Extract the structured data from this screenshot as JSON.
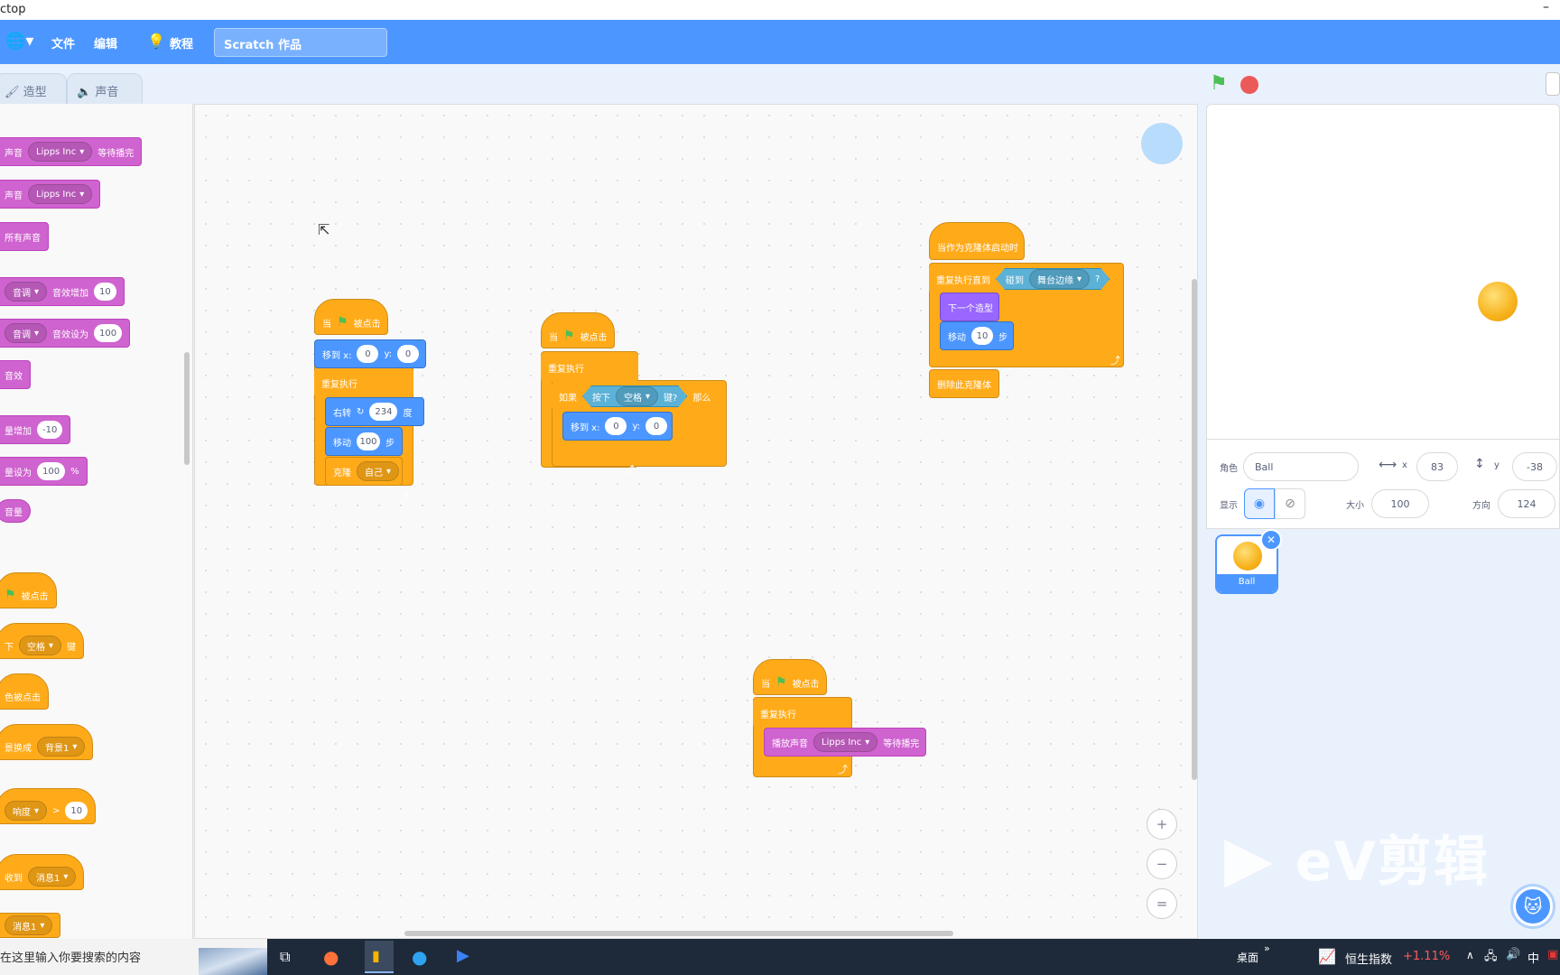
{
  "window": {
    "title": "ctop",
    "minimize": "–"
  },
  "menubar": {
    "file": "文件",
    "edit": "编辑",
    "tutorial": "教程",
    "project_title": "Scratch 作品"
  },
  "tabs": [
    {
      "label": "造型"
    },
    {
      "label": "声音"
    }
  ],
  "palette": {
    "b1": {
      "text": "声音",
      "dd": "Lipps Inc",
      "tail": "等待播完"
    },
    "b2": {
      "text": "声音",
      "dd": "Lipps Inc"
    },
    "b3": {
      "text": "所有声音"
    },
    "b4": {
      "dd": "音调",
      "text": "音效增加",
      "val": "10"
    },
    "b5": {
      "dd": "音调",
      "text": "音效设为",
      "val": "100"
    },
    "b6": {
      "text": "音效"
    },
    "b7": {
      "text": "量增加",
      "val": "-10"
    },
    "b8": {
      "text": "量设为",
      "val": "100",
      "tail": "%"
    },
    "b9": {
      "text": "音量"
    },
    "b10": {
      "text": "被点击"
    },
    "b11": {
      "text": "下",
      "dd": "空格",
      "tail": "键"
    },
    "b12": {
      "text": "色被点击"
    },
    "b13": {
      "text": "景换成",
      "dd": "背景1"
    },
    "b14": {
      "dd": "响度",
      "text": ">",
      "val": "10"
    },
    "b15": {
      "text": "收到",
      "dd": "消息1"
    },
    "b16": {
      "dd": "消息1"
    }
  },
  "scripts": {
    "s1": {
      "hat_a": "当",
      "hat_b": "被点击",
      "goto": "移到 x:",
      "x": "0",
      "y_label": "y:",
      "y": "0",
      "forever": "重复执行",
      "turn": "右转",
      "turn_val": "234",
      "deg": "度",
      "move": "移动",
      "move_val": "100",
      "steps": "步",
      "clone": "克隆",
      "clone_dd": "自己"
    },
    "s2": {
      "hat_a": "当",
      "hat_b": "被点击",
      "forever": "重复执行",
      "if": "如果",
      "key_a": "按下",
      "key_dd": "空格",
      "key_b": "键?",
      "then": "那么",
      "goto": "移到 x:",
      "x": "0",
      "y_label": "y:",
      "y": "0"
    },
    "s3": {
      "hat": "当作为克隆体启动时",
      "repeat_until": "重复执行直到",
      "touch": "碰到",
      "touch_dd": "舞台边缘",
      "q": "?",
      "next_costume": "下一个造型",
      "move": "移动",
      "move_val": "10",
      "steps": "步",
      "delete": "删除此克隆体"
    },
    "s4": {
      "hat_a": "当",
      "hat_b": "被点击",
      "forever": "重复执行",
      "play": "播放声音",
      "play_dd": "Lipps Inc",
      "wait": "等待播完"
    }
  },
  "sprite_info": {
    "sprite_label": "角色",
    "sprite_name": "Ball",
    "x_label": "x",
    "x": "83",
    "y_label": "y",
    "y": "-38",
    "show_label": "显示",
    "size_label": "大小",
    "size": "100",
    "direction_label": "方向",
    "direction": "124"
  },
  "sprite_list": [
    {
      "name": "Ball"
    }
  ],
  "zoom": {
    "in": "+",
    "out": "−",
    "reset": "="
  },
  "watermark": "eV剪辑",
  "taskbar": {
    "search": "在这里输入你要搜索的内容",
    "desktop": "桌面",
    "stock_name": "恒生指数",
    "stock_change": "+1.11%",
    "ime": "中"
  },
  "colors": {
    "menubar": "#4c97ff",
    "sound": "#cf63cf",
    "motion": "#4c97ff",
    "control": "#ffab19",
    "looks": "#9966ff",
    "sensing": "#5cb1d6"
  }
}
